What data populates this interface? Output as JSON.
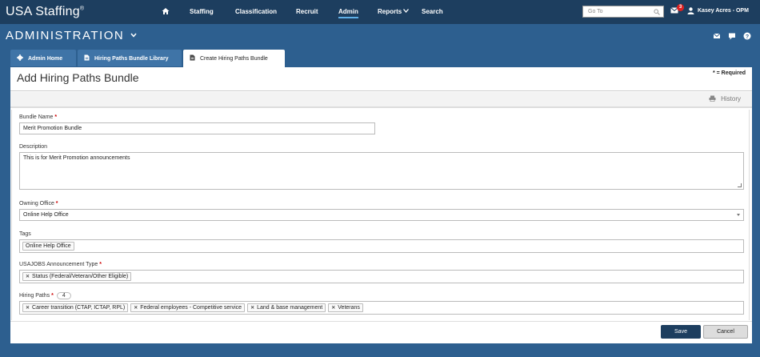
{
  "app": {
    "brand": "USA Staffing",
    "brand_mark": "®"
  },
  "nav": {
    "items": [
      {
        "label": "Staffing"
      },
      {
        "label": "Classification"
      },
      {
        "label": "Recruit"
      },
      {
        "label": "Admin"
      },
      {
        "label": "Reports"
      },
      {
        "label": "Search"
      }
    ],
    "active": "Admin"
  },
  "goto": {
    "placeholder": "Go To"
  },
  "user": {
    "name": "Kasey Acres - OPM",
    "mail_count": "3"
  },
  "section": {
    "title": "ADMINISTRATION"
  },
  "tabs": [
    {
      "label": "Admin Home"
    },
    {
      "label": "Hiring Paths Bundle Library"
    },
    {
      "label": "Create Hiring Paths Bundle"
    }
  ],
  "page": {
    "title": "Add Hiring Paths Bundle",
    "required_note": "* = Required",
    "history_label": "History"
  },
  "form": {
    "bundle_name": {
      "label": "Bundle Name",
      "value": "Merit Promotion Bundle"
    },
    "description": {
      "label": "Description",
      "value": "This is for Merit Promotion announcements"
    },
    "owning_office": {
      "label": "Owning Office",
      "value": "Online Help Office"
    },
    "tags": {
      "label": "Tags",
      "values": [
        "Online Help Office"
      ]
    },
    "announcement_type": {
      "label": "USAJOBS Announcement Type",
      "values": [
        "Status (Federal/Veteran/Other Eligible)"
      ]
    },
    "hiring_paths": {
      "label": "Hiring Paths",
      "count": "4",
      "values": [
        "Career transition (CTAP, ICTAP, RPL)",
        "Federal employees - Competitive service",
        "Land & base management",
        "Veterans"
      ]
    },
    "required_marker": "*"
  },
  "actions": {
    "save": "Save",
    "cancel": "Cancel"
  },
  "colors": {
    "nav_bg": "#1d3e5f",
    "header_bg": "#2d5f8f",
    "tab_bg": "#3f74a7",
    "accent": "#5fb0e8",
    "save_bg": "#1d3e5f"
  }
}
